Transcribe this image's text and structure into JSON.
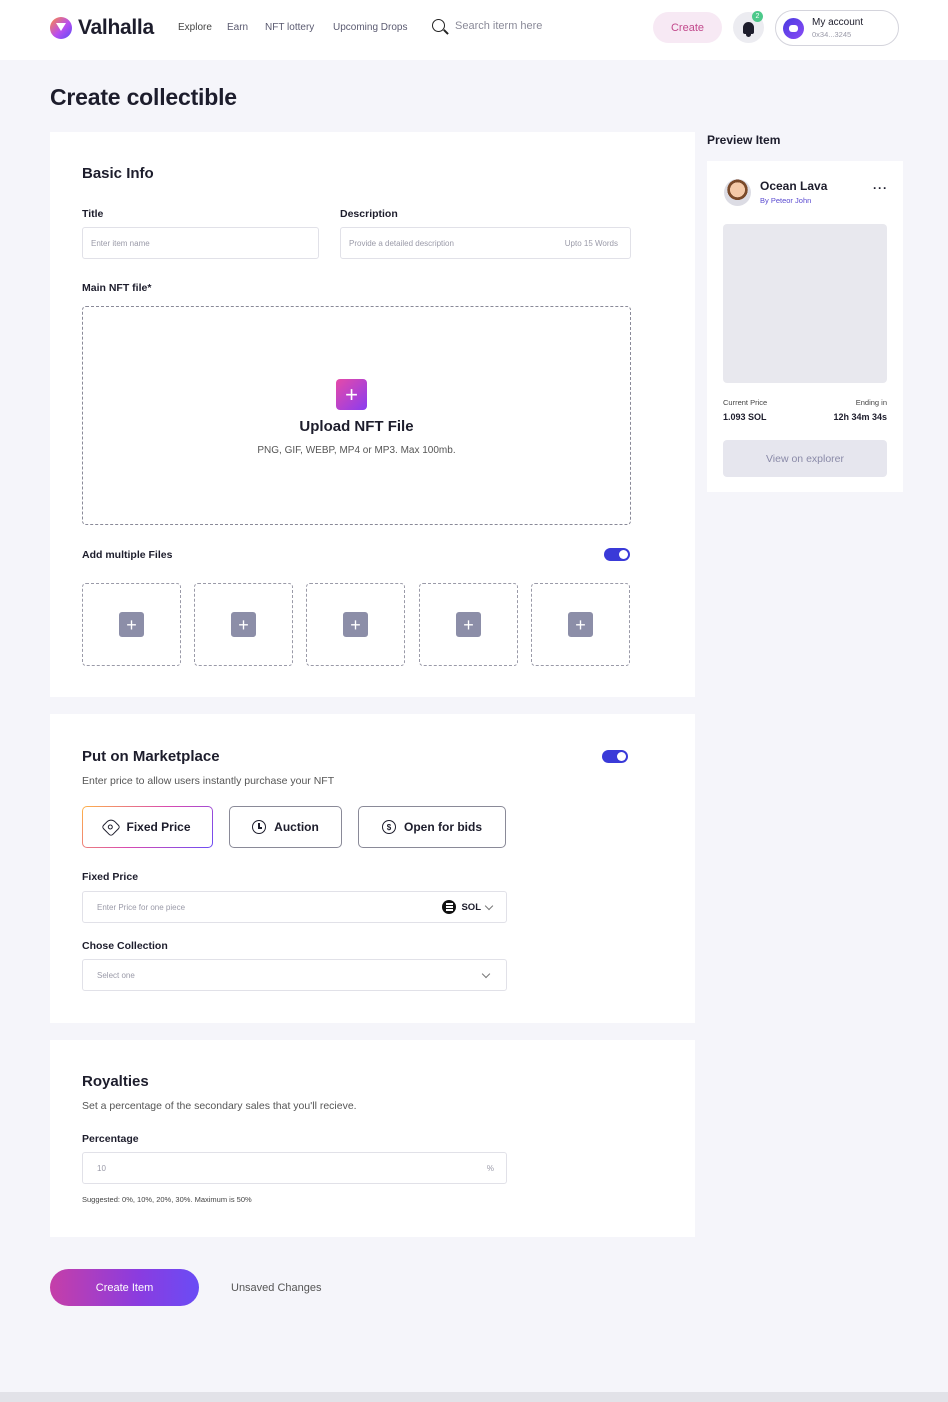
{
  "header": {
    "brand": "Valhalla",
    "nav": [
      "Explore",
      "Earn",
      "NFT lottery",
      "Upcoming Drops"
    ],
    "search_placeholder": "Search iterm here",
    "create_label": "Create",
    "notification_count": "2",
    "account_label": "My account",
    "account_address": "0x34...3245"
  },
  "page": {
    "title": "Create collectible"
  },
  "basic_info": {
    "heading": "Basic Info",
    "title_label": "Title",
    "title_placeholder": "Enter item name",
    "description_label": "Description",
    "description_placeholder": "Provide a detailed description",
    "description_hint": "Upto 15 Words",
    "main_file_label": "Main NFT file*",
    "upload_title": "Upload NFT File",
    "upload_formats": "PNG, GIF, WEBP, MP4 or MP3. Max 100mb.",
    "multiple_files_label": "Add multiple Files",
    "multiple_files_enabled": true
  },
  "marketplace": {
    "heading": "Put on Marketplace",
    "subtitle": "Enter price to allow users instantly purchase your NFT",
    "enabled": true,
    "options": [
      "Fixed Price",
      "Auction",
      "Open for bids"
    ],
    "selected_option": "Fixed Price",
    "price_label": "Fixed Price",
    "price_placeholder": "Enter Price for one piece",
    "currency": "SOL",
    "collection_label": "Chose Collection",
    "collection_placeholder": "Select one"
  },
  "royalties": {
    "heading": "Royalties",
    "subtitle": "Set a percentage of the secondary sales that you'll recieve.",
    "percentage_label": "Percentage",
    "percentage_value": "10",
    "percent_sign": "%",
    "suggestion": "Suggested: 0%, 10%, 20%, 30%. Maximum is 50%"
  },
  "actions": {
    "create_item": "Create Item",
    "unsaved": "Unsaved Changes"
  },
  "preview": {
    "heading": "Preview Item",
    "item_name": "Ocean Lava",
    "creator": "By Peteor John",
    "current_price_label": "Current Price",
    "current_price": "1.093 SOL",
    "ending_label": "Ending in",
    "ending_value": "12h 34m 34s",
    "explorer_button": "View on explorer"
  },
  "colors": {
    "accent": "#3a3ad8",
    "brand_gradient_start": "#c53fa8",
    "brand_gradient_end": "#6a4cf5",
    "background": "#f5f5fa"
  }
}
